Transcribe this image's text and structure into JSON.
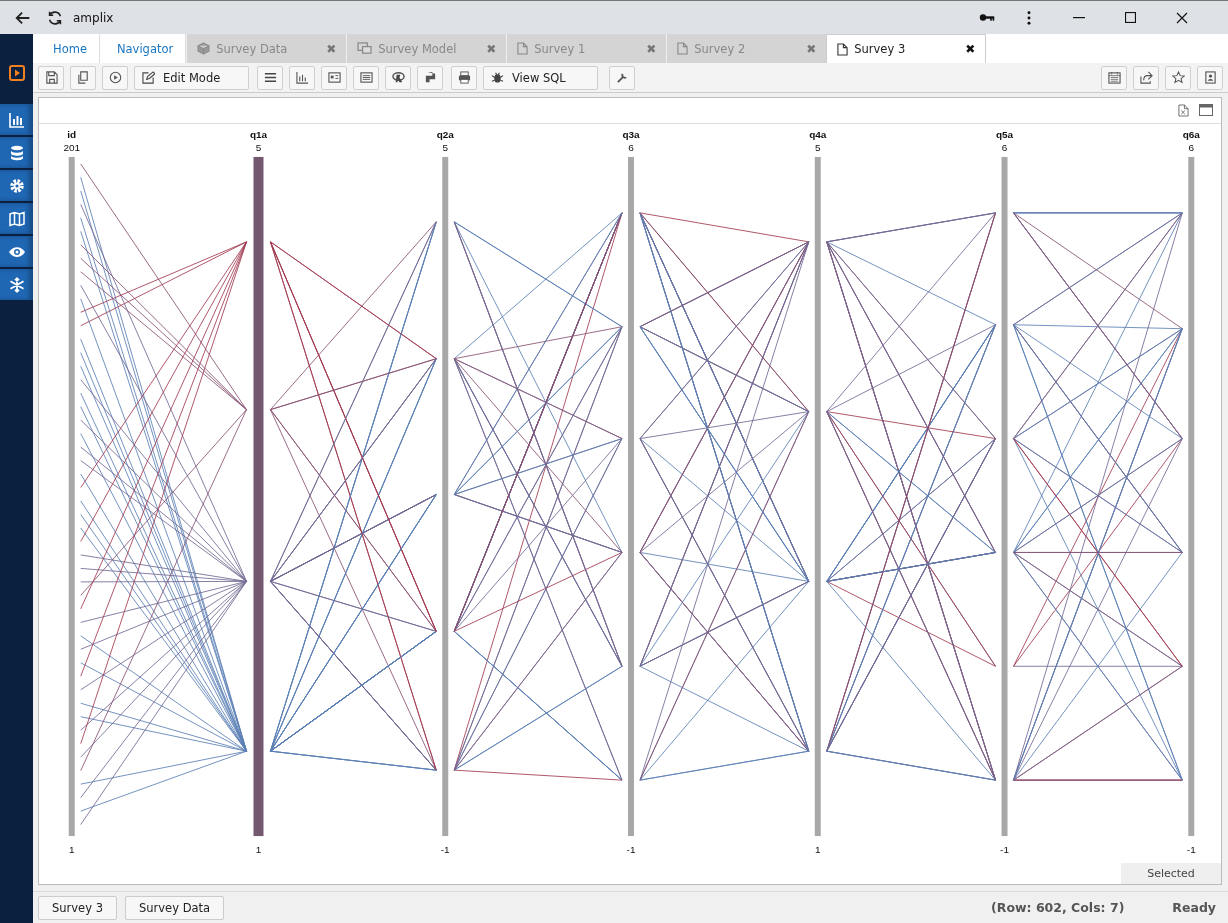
{
  "browser": {
    "title": "amplix"
  },
  "breadcrumbs": [
    "Home",
    "Navigator"
  ],
  "tabs": [
    {
      "kind": "data",
      "label": "Survey Data",
      "selected": false,
      "close": "✖"
    },
    {
      "kind": "model",
      "label": "Survey Model",
      "selected": false,
      "close": "✖"
    },
    {
      "kind": "doc",
      "label": "Survey 1",
      "selected": false,
      "close": "✖"
    },
    {
      "kind": "doc",
      "label": "Survey 2",
      "selected": false,
      "close": "✖"
    },
    {
      "kind": "doc",
      "label": "Survey 3",
      "selected": true,
      "close": "✖"
    }
  ],
  "toolbar": [
    {
      "kind": "icon"
    },
    {
      "kind": "icon"
    },
    {
      "kind": "icon"
    },
    {
      "kind": "text",
      "label": "Edit Mode"
    },
    {
      "kind": "icon"
    },
    {
      "kind": "icon"
    },
    {
      "kind": "icon"
    },
    {
      "kind": "icon"
    },
    {
      "kind": "icon"
    },
    {
      "kind": "icon"
    },
    {
      "kind": "icon"
    },
    {
      "kind": "text",
      "label": "View SQL"
    },
    {
      "kind": "icon"
    }
  ],
  "axes": [
    {
      "name": "id",
      "max": "201",
      "min": "1",
      "selected": false
    },
    {
      "name": "q1a",
      "max": "5",
      "min": "1",
      "selected": true
    },
    {
      "name": "q2a",
      "max": "5",
      "min": "-1",
      "selected": false
    },
    {
      "name": "q3a",
      "max": "6",
      "min": "-1",
      "selected": false
    },
    {
      "name": "q4a",
      "max": "5",
      "min": "1",
      "selected": false
    },
    {
      "name": "q5a",
      "max": "6",
      "min": "-1",
      "selected": false
    },
    {
      "name": "q6a",
      "max": "6",
      "min": "-1",
      "selected": false
    }
  ],
  "selected_label": "Selected",
  "bottom_tabs": [
    "Survey 3",
    "Survey Data"
  ],
  "status": {
    "info": "(Row: 602, Cols: 7)",
    "state": "Ready"
  }
}
